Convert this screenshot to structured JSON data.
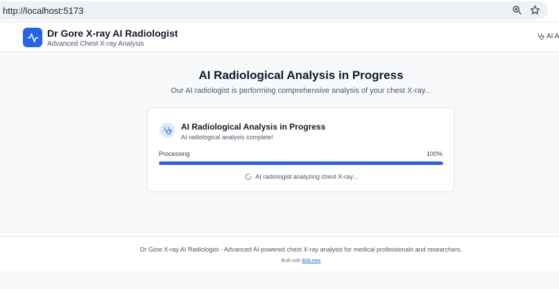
{
  "browser": {
    "url": "http://localhost:5173",
    "icons": [
      "zoom-icon",
      "bookmark-star-icon"
    ]
  },
  "header": {
    "title": "Dr Gore X-ray AI Radiologist",
    "subtitle": "Advanced Chest X-ray Analysis",
    "badge_label": "AI A",
    "logo_icon": "activity-pulse-icon",
    "badge_icon": "stethoscope-icon"
  },
  "main": {
    "heading": "AI Radiological Analysis in Progress",
    "description": "Our AI radiologist is performing comprehensive analysis of your chest X-ray..."
  },
  "card": {
    "title": "AI Radiological Analysis in Progress",
    "status": "AI radiological analysis complete!",
    "progress_label": "Processing",
    "progress_text": "100%",
    "progress_fraction": 1.0,
    "activity": "AI radiologist analyzing chest X-ray...",
    "icon": "stethoscope-icon"
  },
  "footer": {
    "text": "Dr Gore X-ray AI Radiologist - Advanced AI-powered chest X-ray analysis for medical professionals and researchers.",
    "built_prefix": "Built with",
    "built_link": "Bolt.new"
  },
  "colors": {
    "accent": "#2563eb",
    "icon_bg": "#dbeafe",
    "page_bg": "#f8f9fb"
  }
}
